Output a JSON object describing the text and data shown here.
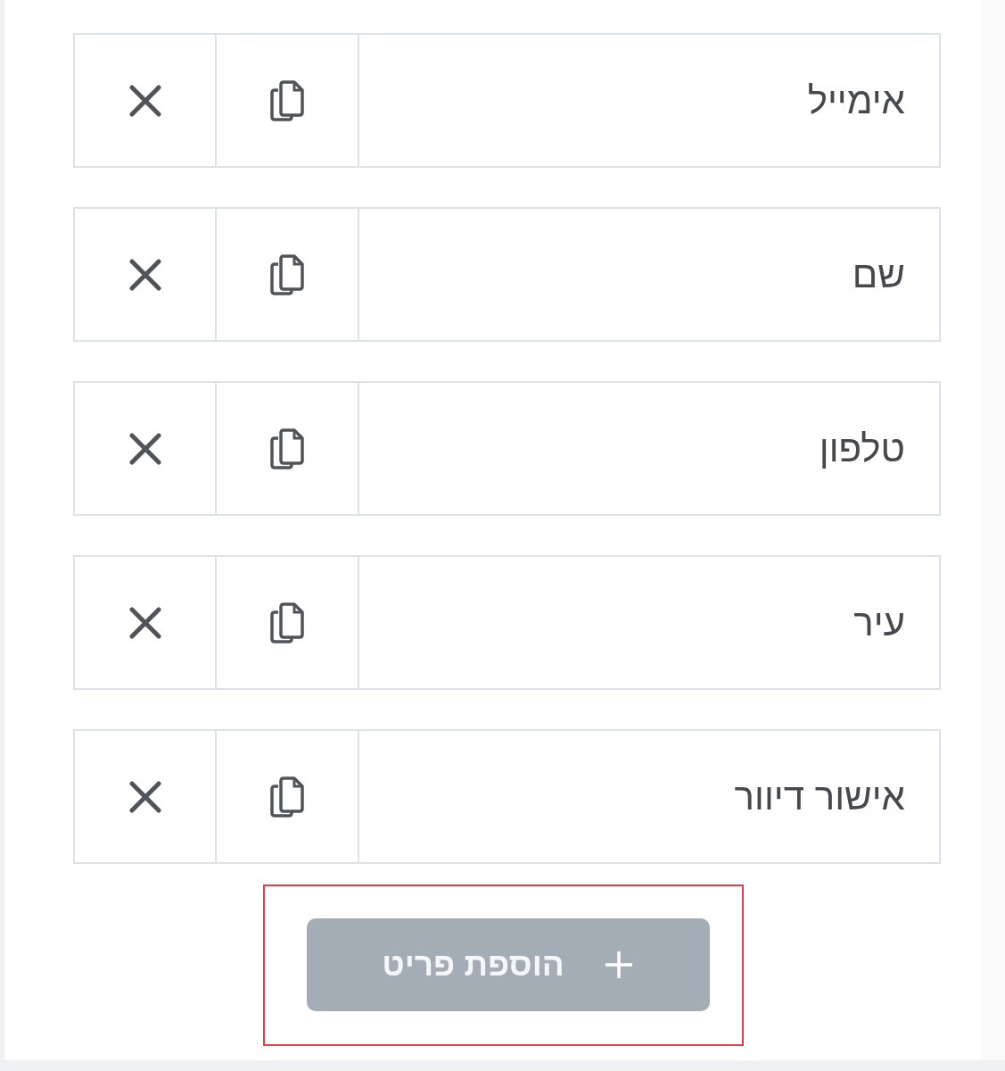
{
  "items": [
    {
      "label": "אימייל"
    },
    {
      "label": "שם"
    },
    {
      "label": "טלפון"
    },
    {
      "label": "עיר"
    },
    {
      "label": "אישור דיוור"
    }
  ],
  "add_button": {
    "label": "הוספת פריט",
    "highlighted": true
  }
}
